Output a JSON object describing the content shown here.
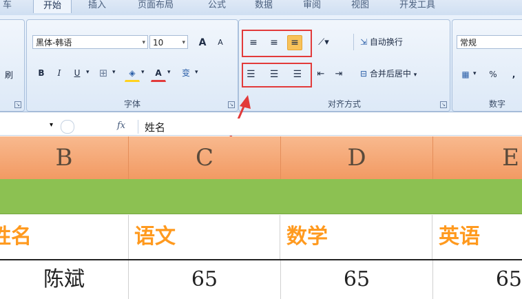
{
  "tabs": [
    "车",
    "开始",
    "插入",
    "页面布局",
    "公式",
    "数据",
    "审阅",
    "视图",
    "开发工具"
  ],
  "font_group": {
    "font_name": "黑体-韩语",
    "font_size": "10",
    "grow_label": "A",
    "shrink_label": "A",
    "bold": "B",
    "italic": "I",
    "underline": "U",
    "font_color_label": "A",
    "phonetic_label": "变",
    "label": "字体",
    "left_edge_label": "刷"
  },
  "align_group": {
    "wrap_text": "自动换行",
    "merge_center": "合并后居中",
    "label": "对齐方式"
  },
  "number_group": {
    "format": "常规",
    "percent": "%",
    "comma": ",",
    "label": "数字"
  },
  "formula_bar": {
    "fx": "fx",
    "content": "姓名"
  },
  "columns": [
    "B",
    "C",
    "D",
    "E"
  ],
  "header_row": [
    "姓名",
    "语文",
    "数学",
    "英语"
  ],
  "data_row": [
    "陈斌",
    "65",
    "65",
    "65"
  ],
  "colors": {
    "highlight_red": "#e23a3a",
    "column_header_orange": "#f29a63",
    "green_band": "#8cc152",
    "header_text_orange": "#ff9a1f"
  }
}
